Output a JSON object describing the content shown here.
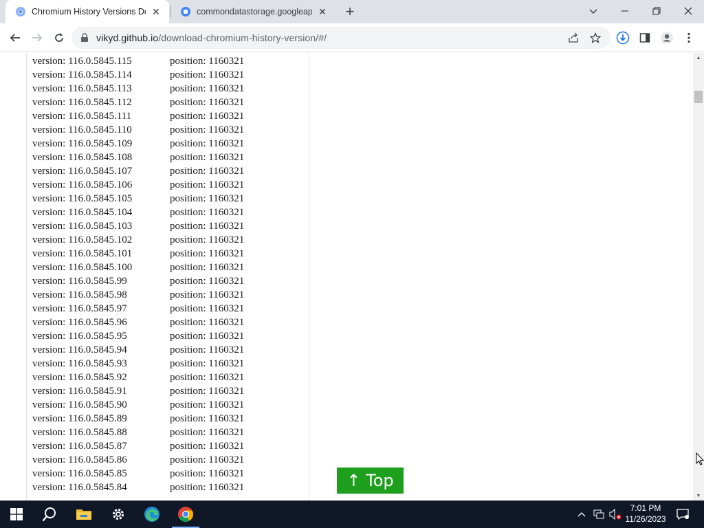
{
  "browser": {
    "tabs": [
      {
        "title": "Chromium History Versions Dow",
        "active": true
      },
      {
        "title": "commondatastorage.googleapis",
        "active": false
      }
    ],
    "url_host": "vikyd.github.io",
    "url_path": "/download-chromium-history-version/#/"
  },
  "page": {
    "rows": [
      {
        "version": "version: 116.0.5845.115",
        "position": "position: 1160321"
      },
      {
        "version": "version: 116.0.5845.114",
        "position": "position: 1160321"
      },
      {
        "version": "version: 116.0.5845.113",
        "position": "position: 1160321"
      },
      {
        "version": "version: 116.0.5845.112",
        "position": "position: 1160321"
      },
      {
        "version": "version: 116.0.5845.111",
        "position": "position: 1160321"
      },
      {
        "version": "version: 116.0.5845.110",
        "position": "position: 1160321"
      },
      {
        "version": "version: 116.0.5845.109",
        "position": "position: 1160321"
      },
      {
        "version": "version: 116.0.5845.108",
        "position": "position: 1160321"
      },
      {
        "version": "version: 116.0.5845.107",
        "position": "position: 1160321"
      },
      {
        "version": "version: 116.0.5845.106",
        "position": "position: 1160321"
      },
      {
        "version": "version: 116.0.5845.105",
        "position": "position: 1160321"
      },
      {
        "version": "version: 116.0.5845.104",
        "position": "position: 1160321"
      },
      {
        "version": "version: 116.0.5845.103",
        "position": "position: 1160321"
      },
      {
        "version": "version: 116.0.5845.102",
        "position": "position: 1160321"
      },
      {
        "version": "version: 116.0.5845.101",
        "position": "position: 1160321"
      },
      {
        "version": "version: 116.0.5845.100",
        "position": "position: 1160321"
      },
      {
        "version": "version: 116.0.5845.99",
        "position": "position: 1160321"
      },
      {
        "version": "version: 116.0.5845.98",
        "position": "position: 1160321"
      },
      {
        "version": "version: 116.0.5845.97",
        "position": "position: 1160321"
      },
      {
        "version": "version: 116.0.5845.96",
        "position": "position: 1160321"
      },
      {
        "version": "version: 116.0.5845.95",
        "position": "position: 1160321"
      },
      {
        "version": "version: 116.0.5845.94",
        "position": "position: 1160321"
      },
      {
        "version": "version: 116.0.5845.93",
        "position": "position: 1160321"
      },
      {
        "version": "version: 116.0.5845.92",
        "position": "position: 1160321"
      },
      {
        "version": "version: 116.0.5845.91",
        "position": "position: 1160321"
      },
      {
        "version": "version: 116.0.5845.90",
        "position": "position: 1160321"
      },
      {
        "version": "version: 116.0.5845.89",
        "position": "position: 1160321"
      },
      {
        "version": "version: 116.0.5845.88",
        "position": "position: 1160321"
      },
      {
        "version": "version: 116.0.5845.87",
        "position": "position: 1160321"
      },
      {
        "version": "version: 116.0.5845.86",
        "position": "position: 1160321"
      },
      {
        "version": "version: 116.0.5845.85",
        "position": "position: 1160321"
      },
      {
        "version": "version: 116.0.5845.84",
        "position": "position: 1160321"
      }
    ],
    "top_button_label": "↑ Top"
  },
  "taskbar": {
    "time": "7:01 PM",
    "date": "11/26/2023",
    "apps": [
      "start-icon",
      "search-icon",
      "file-explorer-icon",
      "settings-icon",
      "edge-icon",
      "chrome-icon"
    ]
  },
  "colors": {
    "top_button": "#1ea01e",
    "taskbar": "#101828"
  }
}
